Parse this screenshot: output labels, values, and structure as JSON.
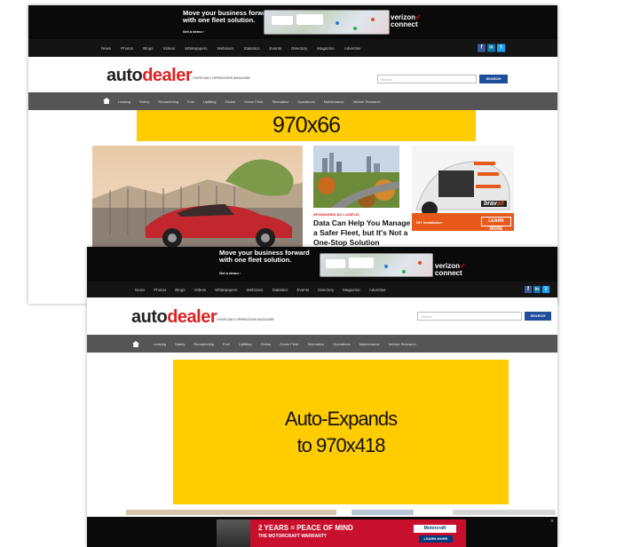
{
  "top_ad": {
    "tagline_line1": "Move your business forward",
    "tagline_line2": "with one fleet solution.",
    "cta": "Get a demo ›",
    "brand_line1": "verizon",
    "brand_check": "✓",
    "brand_line2": "connect"
  },
  "nav": {
    "items": [
      "News",
      "Photos",
      "Blogs",
      "Videos",
      "Whitepapers",
      "Webinars",
      "Statistics",
      "Events",
      "Directory",
      "Magazine",
      "Advertise"
    ],
    "social": [
      "f",
      "in",
      "t"
    ]
  },
  "masthead": {
    "logo_auto": "auto",
    "logo_dealer": "dealer",
    "tagline": "YOUR DAILY OPERATIONS MAGAZINE",
    "search_placeholder": "Search",
    "search_button": "SEARCH"
  },
  "categories": [
    "Leasing",
    "Safety",
    "Remarketing",
    "Fuel",
    "Upfitting",
    "Global",
    "Green Fleet",
    "Telematics",
    "Operations",
    "Maintenance",
    "Vehicle Research"
  ],
  "ad_slot_collapsed": "970x66",
  "ad_slot_expanded_line1": "Auto-Expands",
  "ad_slot_expanded_line2": "to 970x418",
  "story": {
    "sponsor": "SPONSORED BY LOGIFLIX",
    "headline_line1": "Data Can Help You Manage",
    "headline_line2": "a Safer Fleet, but It's Not a",
    "headline_line3": "One-Stop Solution"
  },
  "right_ad": {
    "brand": "brav",
    "brand_suffix": "all",
    "footer_left": "DIY Installation",
    "cta": "LEARN MORE"
  },
  "bottom_ad": {
    "headline": "2 YEARS = PEACE OF MIND",
    "subline": "THE MOTORCRAFT WARRANTY",
    "logo": "Motorcraft",
    "cta": "LEARN MORE"
  },
  "colors": {
    "ad_yellow": "#ffcc00",
    "brand_red": "#dd2222",
    "search_blue": "#1f4e9c",
    "nav_dark": "#141414",
    "category_gray": "#555555"
  }
}
